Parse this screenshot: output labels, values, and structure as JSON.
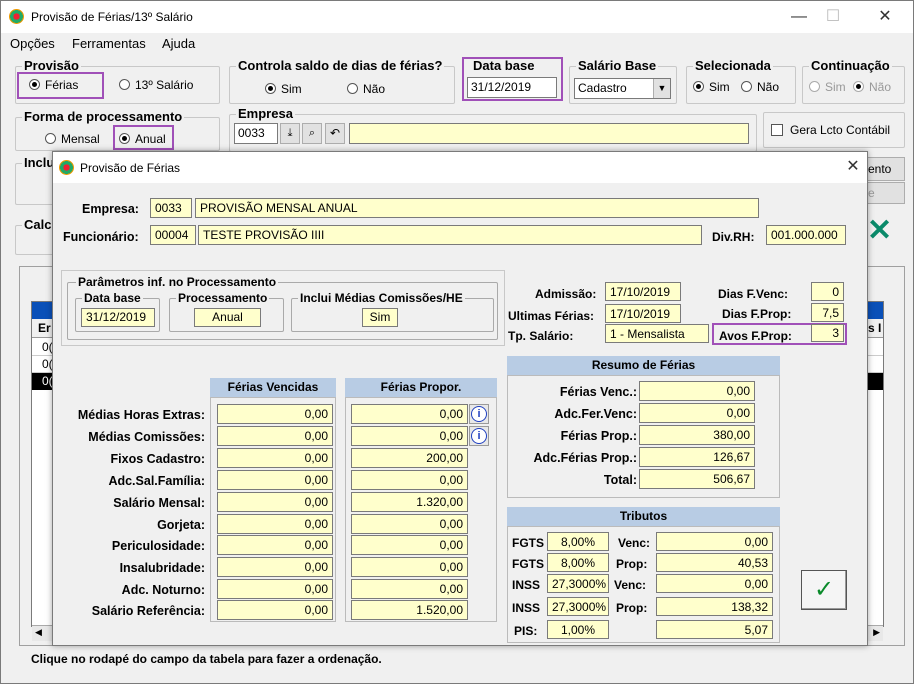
{
  "main": {
    "title": "Provisão de Férias/13º Salário",
    "window_controls": {
      "minimize": "—",
      "maximize": "☐",
      "close": "✕"
    },
    "menu": [
      "Opções",
      "Ferramentas",
      "Ajuda"
    ],
    "provisao": {
      "label": "Provisão",
      "ferias": "Férias",
      "decimo": "13º Salário",
      "selected": "Férias"
    },
    "controla_saldo": {
      "label": "Controla saldo de dias de férias?",
      "sim": "Sim",
      "nao": "Não",
      "selected": "Sim"
    },
    "data_base": {
      "label": "Data base",
      "value": "31/12/2019"
    },
    "salario_base": {
      "label": "Salário Base",
      "value": "Cadastro"
    },
    "selecionada": {
      "label": "Selecionada",
      "sim": "Sim",
      "nao": "Não",
      "selected": "Sim"
    },
    "continuacao": {
      "label": "Continuação",
      "sim": "Sim",
      "nao": "Não",
      "selected": "Não"
    },
    "forma_processamento": {
      "label": "Forma de processamento",
      "mensal": "Mensal",
      "anual": "Anual",
      "selected": "Anual"
    },
    "empresa": {
      "label": "Empresa",
      "code": "0033",
      "name": ""
    },
    "gera_lcto": {
      "label": "Gera Lcto Contábil",
      "checked": false
    },
    "truncated_labels": {
      "inclui": "Inclu",
      "calc": "Calc",
      "btn1": "ento",
      "btn2": "e"
    },
    "grid": {
      "col1": "Er",
      "col2": "s I",
      "row1": "0(",
      "row2": "0(",
      "row3": "0("
    },
    "status": "Clique no rodapé do campo da tabela  para fazer a ordenação."
  },
  "dialog": {
    "title": "Provisão de Férias",
    "close": "✕",
    "empresa": {
      "label": "Empresa:",
      "code": "0033",
      "name": "PROVISÃO MENSAL ANUAL"
    },
    "funcionario": {
      "label": "Funcionário:",
      "code": "00004",
      "name": "TESTE PROVISÃO IIII"
    },
    "div_rh": {
      "label": "Div.RH:",
      "value": "001.000.000"
    },
    "parametros": {
      "label": "Parâmetros inf. no Processamento",
      "data_base_label": "Data base",
      "data_base": "31/12/2019",
      "processamento_label": "Processamento",
      "processamento": "Anual",
      "inclui_label": "Inclui Médias Comissões/HE",
      "inclui": "Sim"
    },
    "admissao": {
      "label": "Admissão:",
      "value": "17/10/2019"
    },
    "ultimas_ferias": {
      "label": "Ultimas Férias:",
      "value": "17/10/2019"
    },
    "tp_salario": {
      "label": "Tp. Salário:",
      "value": "1 - Mensalista"
    },
    "dias_fvenc": {
      "label": "Dias F.Venc:",
      "value": "0"
    },
    "dias_fprop": {
      "label": "Dias F.Prop:",
      "value": "7,5"
    },
    "avos_fprop": {
      "label": "Avos F.Prop:",
      "value": "3"
    },
    "col_vencidas": "Férias Vencidas",
    "col_propor": "Férias Propor.",
    "rows": [
      {
        "label": "Médias Horas Extras:",
        "vencidas": "0,00",
        "propor": "0,00"
      },
      {
        "label": "Médias Comissões:",
        "vencidas": "0,00",
        "propor": "0,00"
      },
      {
        "label": "Fixos Cadastro:",
        "vencidas": "0,00",
        "propor": "200,00"
      },
      {
        "label": "Adc.Sal.Família:",
        "vencidas": "0,00",
        "propor": "0,00"
      },
      {
        "label": "Salário Mensal:",
        "vencidas": "0,00",
        "propor": "1.320,00"
      },
      {
        "label": "Gorjeta:",
        "vencidas": "0,00",
        "propor": "0,00"
      },
      {
        "label": "Periculosidade:",
        "vencidas": "0,00",
        "propor": "0,00"
      },
      {
        "label": "Insalubridade:",
        "vencidas": "0,00",
        "propor": "0,00"
      },
      {
        "label": "Adc. Noturno:",
        "vencidas": "0,00",
        "propor": "0,00"
      },
      {
        "label": "Salário Referência:",
        "vencidas": "0,00",
        "propor": "1.520,00"
      }
    ],
    "resumo": {
      "title": "Resumo de Férias",
      "items": [
        {
          "label": "Férias Venc.:",
          "value": "0,00"
        },
        {
          "label": "Adc.Fer.Venc:",
          "value": "0,00"
        },
        {
          "label": "Férias Prop.:",
          "value": "380,00"
        },
        {
          "label": "Adc.Férias Prop.:",
          "value": "126,67"
        },
        {
          "label": "Total:",
          "value": "506,67"
        }
      ]
    },
    "tributos": {
      "title": "Tributos",
      "fgts_venc": {
        "label": "FGTS",
        "pct": "8,00%",
        "type": "Venc:",
        "value": "0,00"
      },
      "fgts_prop": {
        "label": "FGTS",
        "pct": "8,00%",
        "type": "Prop:",
        "value": "40,53"
      },
      "inss_venc": {
        "label": "INSS",
        "pct": "27,3000%",
        "type": "Venc:",
        "value": "0,00"
      },
      "inss_prop": {
        "label": "INSS",
        "pct": "27,3000%",
        "type": "Prop:",
        "value": "138,32"
      },
      "pis": {
        "label": "PIS:",
        "pct": "1,00%",
        "value": "5,07"
      }
    },
    "ok_glyph": "✓"
  },
  "colors": {
    "highlight": "#a050b8",
    "field_yellow": "#ffffcc",
    "header_blue": "#b8cce4",
    "ok_green": "#0a8a2a"
  }
}
